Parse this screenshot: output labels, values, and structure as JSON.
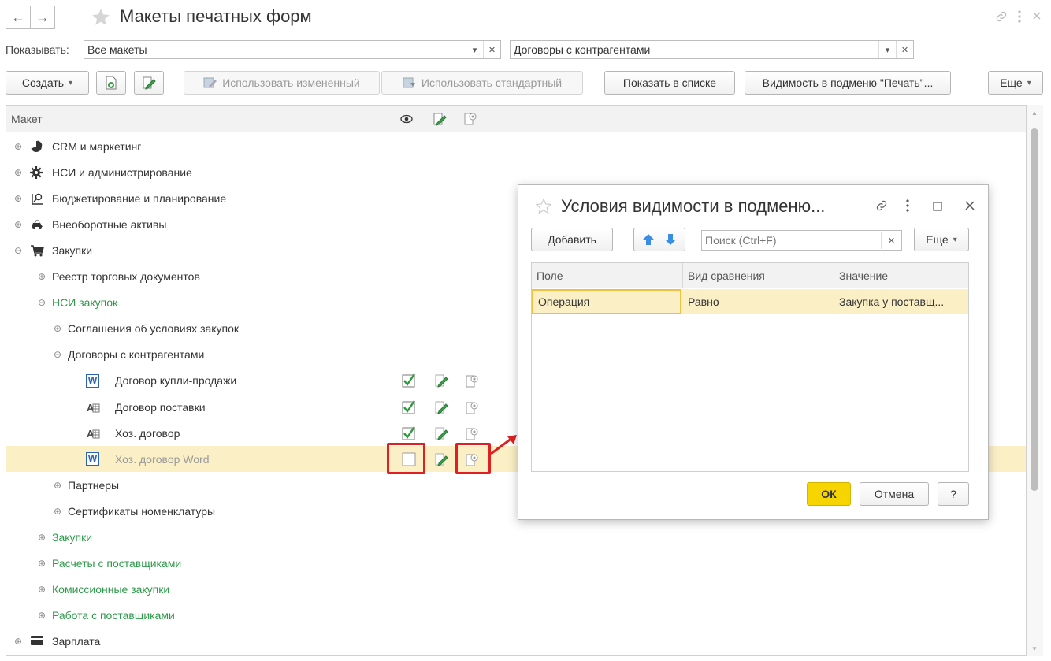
{
  "window": {
    "title": "Макеты печатных форм",
    "back_glyph": "←",
    "forward_glyph": "→"
  },
  "filters": {
    "show_label": "Показывать:",
    "show_value": "Все макеты",
    "object_value": "Договоры с контрагентами"
  },
  "toolbar": {
    "create_label": "Создать",
    "use_modified_label": "Использовать измененный",
    "use_standard_label": "Использовать стандартный",
    "show_in_list_label": "Показать в списке",
    "visibility_label": "Видимость в подменю \"Печать\"...",
    "more_label": "Еще"
  },
  "grid": {
    "header_template": "Макет",
    "rows": [
      {
        "label": "CRM и маркетинг",
        "level": 0,
        "icon": "pie-chart-icon"
      },
      {
        "label": "НСИ и администрирование",
        "level": 0,
        "icon": "gear-icon"
      },
      {
        "label": "Бюджетирование и планирование",
        "level": 0,
        "icon": "budget-icon"
      },
      {
        "label": "Внеоборотные активы",
        "level": 0,
        "icon": "car-icon"
      },
      {
        "label": "Закупки",
        "level": 0,
        "icon": "cart-icon"
      },
      {
        "label": "Реестр торговых документов",
        "level": 1
      },
      {
        "label": "НСИ закупок",
        "level": 1
      },
      {
        "label": "Соглашения об условиях закупок",
        "level": 2
      },
      {
        "label": "Договоры с контрагентами",
        "level": 2
      },
      {
        "label": "Договор купли-продажи",
        "level": 3,
        "type": "word",
        "visible": true
      },
      {
        "label": "Договор поставки",
        "level": 3,
        "type": "mxl",
        "visible": true
      },
      {
        "label": "Хоз. договор",
        "level": 3,
        "type": "mxl",
        "visible": true
      },
      {
        "label": "Хоз. договор Word",
        "level": 3,
        "type": "word",
        "visible": false
      },
      {
        "label": "Партнеры",
        "level": 2
      },
      {
        "label": "Сертификаты номенклатуры",
        "level": 2
      },
      {
        "label": "Закупки",
        "level": 1
      },
      {
        "label": "Расчеты с поставщиками",
        "level": 1
      },
      {
        "label": "Комиссионные закупки",
        "level": 1
      },
      {
        "label": "Работа с поставщиками",
        "level": 1
      },
      {
        "label": "Зарплата",
        "level": 0,
        "icon": "wallet-icon"
      }
    ]
  },
  "dialog": {
    "title": "Условия видимости в подменю...",
    "add_label": "Добавить",
    "search_placeholder": "Поиск (Ctrl+F)",
    "more_label": "Еще",
    "columns": [
      "Поле",
      "Вид сравнения",
      "Значение"
    ],
    "row": {
      "field": "Операция",
      "comparison": "Равно",
      "value": "Закупка у поставщ..."
    },
    "ok_label": "ОК",
    "cancel_label": "Отмена",
    "help_label": "?"
  },
  "colors": {
    "green_text": "#2e9a4a",
    "selection": "#fbefc6",
    "highlight": "#e02020",
    "ok_button": "#f5d400"
  }
}
